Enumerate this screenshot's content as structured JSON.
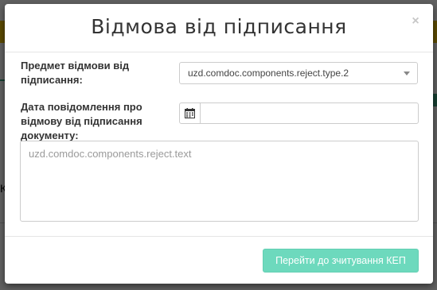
{
  "background": {
    "partial_text": "К"
  },
  "modal": {
    "title": "Відмова від підписання",
    "close_glyph": "×",
    "reason_field": {
      "label": "Предмет відмови від підписання:",
      "selected_value": "uzd.comdoc.components.reject.type.2"
    },
    "date_field": {
      "label": "Дата повідомлення про відмову від підписання документу:",
      "value": "",
      "icon": "calendar-icon"
    },
    "comment_field": {
      "placeholder": "uzd.comdoc.components.reject.text",
      "value": ""
    },
    "submit_label": "Перейти до зчитування КЕП"
  },
  "colors": {
    "accent": "#6dd9bd",
    "banner": "#f2c200",
    "brand_green": "#3aa581"
  }
}
